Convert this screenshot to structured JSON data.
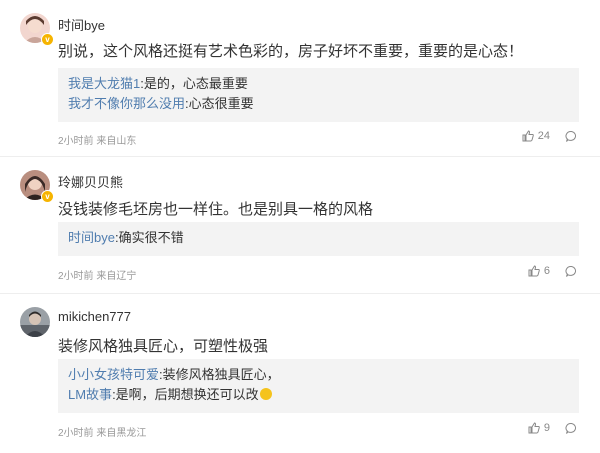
{
  "comments": [
    {
      "username": "时间bye",
      "text": "别说，这个风格还挺有艺术色彩的，房子好坏不重要，重要的是心态！",
      "replies": [
        {
          "user": "我是大龙猫1",
          "text": ":是的，心态最重要"
        },
        {
          "user": "我才不像你那么没用",
          "text": ":心态很重要"
        }
      ],
      "meta": "2小时前 来自山东",
      "likes": "24",
      "avatar_colors": [
        "#e7b9b0",
        "#6b4a3e"
      ]
    },
    {
      "username": "玲娜贝贝熊",
      "text": "没钱装修毛坯房也一样住。也是别具一格的风格",
      "replies": [
        {
          "user": "时间bye",
          "text": ":确实很不错"
        }
      ],
      "meta": "2小时前 来自辽宁",
      "likes": "6",
      "avatar_colors": [
        "#d9a08c",
        "#3a2a26"
      ]
    },
    {
      "username": "mikichen777",
      "text": "装修风格独具匠心，可塑性极强",
      "replies": [
        {
          "user": "小小女孩特可爱",
          "text": ":装修风格独具匠心，"
        },
        {
          "user": "LM故事",
          "text": ":是啊，后期想换还可以改",
          "emoji": "grin-emoji"
        }
      ],
      "meta": "2小时前 来自黑龙江",
      "likes": "9",
      "avatar_colors": [
        "#8a8f96",
        "#3c4047"
      ]
    }
  ],
  "colors": {
    "link": "#507daf",
    "verified_badge": "#f6b400",
    "reply_bg": "#f3f3f3"
  },
  "icons": {
    "like": "thumbs-up-icon",
    "reply": "comment-bubble-icon",
    "verified": "verified-badge-icon"
  }
}
